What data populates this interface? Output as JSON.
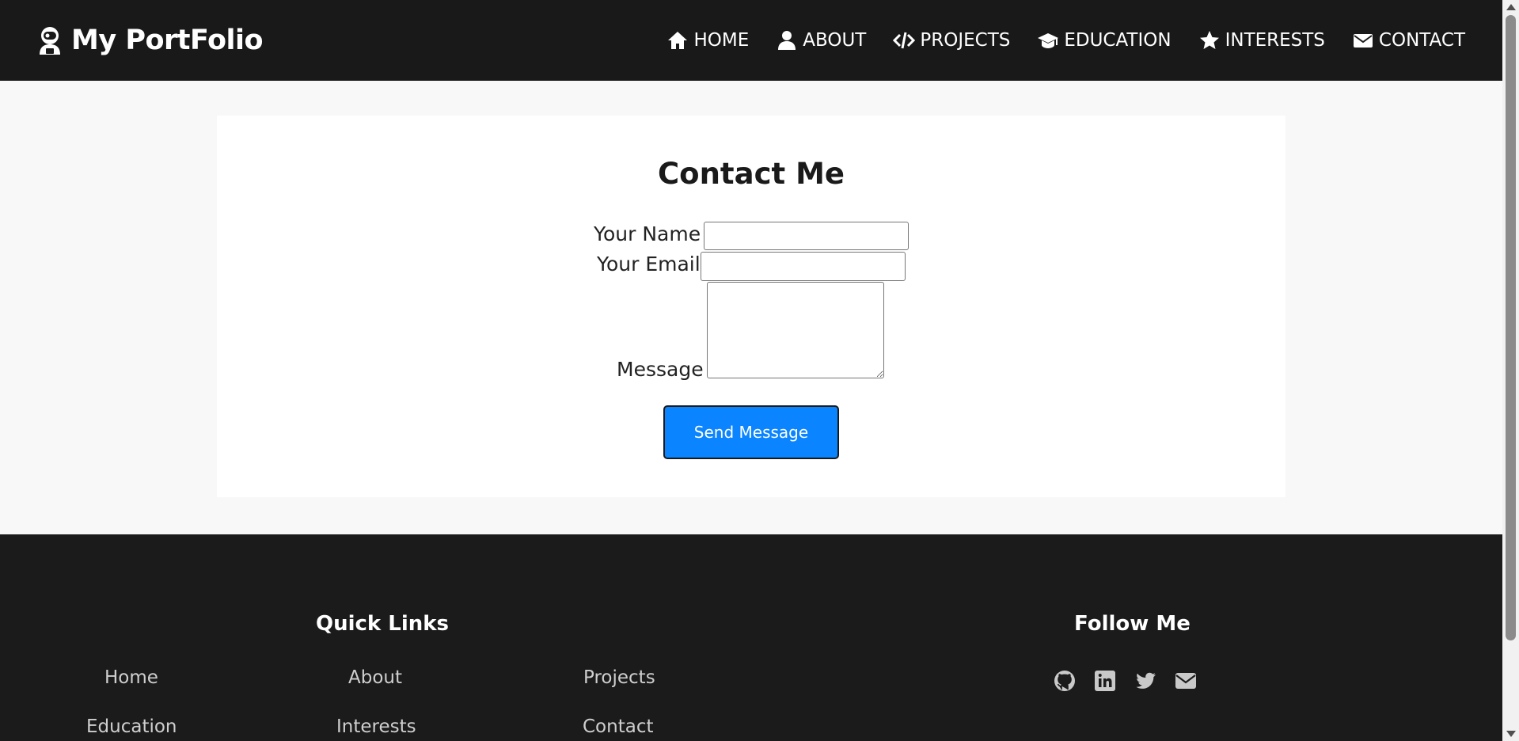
{
  "header": {
    "brand": "My PortFolio",
    "brand_icon": "astronaut-icon",
    "nav": [
      {
        "label": "HOME",
        "icon": "home-icon"
      },
      {
        "label": "ABOUT",
        "icon": "user-icon"
      },
      {
        "label": "PROJECTS",
        "icon": "code-icon"
      },
      {
        "label": "EDUCATION",
        "icon": "graduation-cap-icon"
      },
      {
        "label": "INTERESTS",
        "icon": "star-icon"
      },
      {
        "label": "CONTACT",
        "icon": "envelope-icon"
      }
    ]
  },
  "contact": {
    "title": "Contact Me",
    "name_label": "Your Name",
    "name_value": "",
    "email_label": "Your Email",
    "email_value": "",
    "message_label": "Message",
    "message_value": "",
    "send_label": "Send Message"
  },
  "footer": {
    "quick_links_title": "Quick Links",
    "links": [
      "Home",
      "About",
      "Projects",
      "Education",
      "Interests",
      "Contact"
    ],
    "follow_title": "Follow Me",
    "social": [
      "github-icon",
      "linkedin-icon",
      "twitter-icon",
      "envelope-icon"
    ]
  },
  "colors": {
    "nav_bg": "#191919",
    "accent": "#0a84ff",
    "page_bg": "#f8f8f8",
    "footer_bg": "#1b1b1b"
  }
}
